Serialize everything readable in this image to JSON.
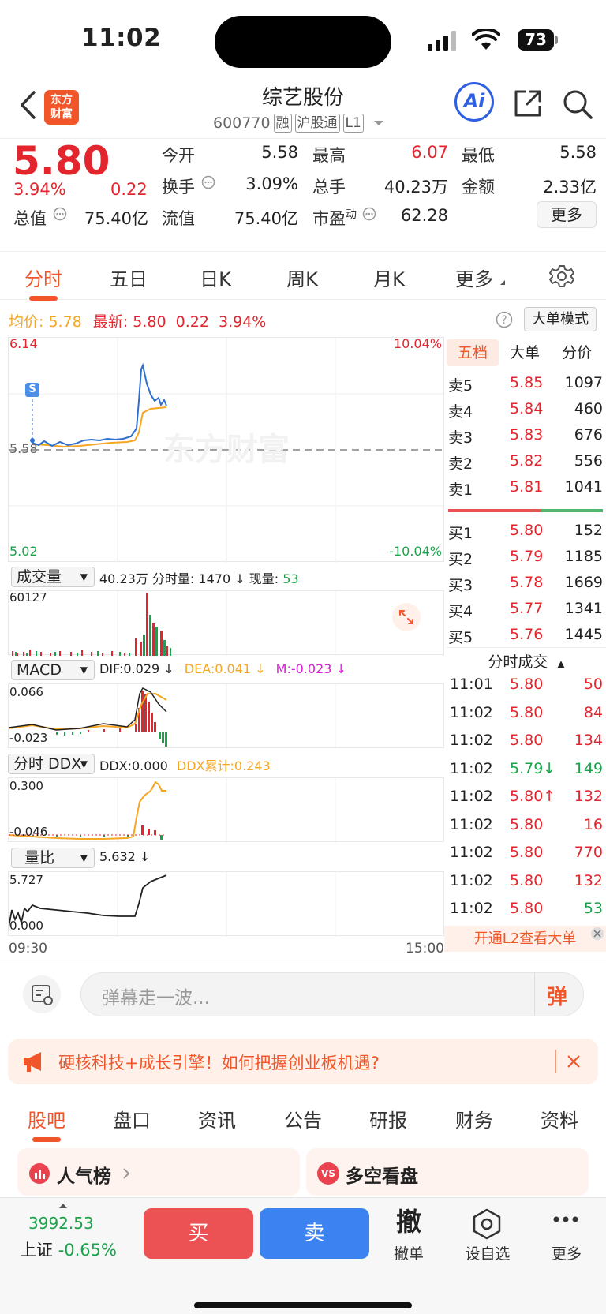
{
  "status": {
    "time": "11:02",
    "battery": "73"
  },
  "header": {
    "logo_line1": "东方",
    "logo_line2": "财富",
    "stock_name": "综艺股份",
    "stock_code": "600770",
    "tags": [
      "融",
      "沪股通",
      "L1"
    ],
    "ai_label": "Ai"
  },
  "quote": {
    "price": "5.80",
    "change_pct": "3.94%",
    "change": "0.22",
    "total_value_label": "总值",
    "total_value": "75.40亿",
    "open_label": "今开",
    "open": "5.58",
    "high_label": "最高",
    "high": "6.07",
    "low_label": "最低",
    "low": "5.58",
    "turnover_label": "换手",
    "turnover": "3.09%",
    "volume_label": "总手",
    "volume": "40.23万",
    "amount_label": "金额",
    "amount": "2.33亿",
    "float_label": "流值",
    "float_value": "75.40亿",
    "pe_label": "市盈",
    "pe_sup": "动",
    "pe": "62.28",
    "more_button": "更多"
  },
  "chart_tabs": [
    "分时",
    "五日",
    "日K",
    "周K",
    "月K",
    "更多"
  ],
  "legend": {
    "avg_label": "均价:",
    "avg": "5.78",
    "latest_label": "最新:",
    "latest": "5.80",
    "latest_change": "0.22",
    "latest_pct": "3.94%",
    "big_order_mode": "大单模式"
  },
  "main_chart": {
    "y_top": "6.14",
    "y_bottom": "5.02",
    "pct_top": "10.04%",
    "pct_bottom": "-10.04%",
    "ref_label": "5.58",
    "marker": "S",
    "watermark": "东方财富"
  },
  "volume_panel": {
    "select": "成交量",
    "total": "40.23万",
    "tick_label": "分时量:",
    "tick_value": "1470 ↓",
    "now_label": "现量:",
    "now_value": "53",
    "y_top": "60127"
  },
  "macd_panel": {
    "select": "MACD",
    "dif": "DIF:0.029 ↓",
    "dea": "DEA:0.041 ↓",
    "m": "M:-0.023 ↓",
    "y_top": "0.066",
    "y_bottom": "-0.023"
  },
  "ddx_panel": {
    "select": "分时 DDX",
    "ddx": "DDX:0.000",
    "ddx_sum": "DDX累计:0.243",
    "y_top": "0.300",
    "y_bottom": "-0.046"
  },
  "ratio_panel": {
    "select": "量比",
    "value": "5.632 ↓",
    "y_top": "5.727",
    "y_bottom": "0.000"
  },
  "time_axis": {
    "start": "09:30",
    "end": "15:00"
  },
  "orderbook_tabs": [
    "五档",
    "大单",
    "分价"
  ],
  "asks": [
    {
      "label": "卖5",
      "price": "5.85",
      "qty": "1097"
    },
    {
      "label": "卖4",
      "price": "5.84",
      "qty": "460"
    },
    {
      "label": "卖3",
      "price": "5.83",
      "qty": "676"
    },
    {
      "label": "卖2",
      "price": "5.82",
      "qty": "556"
    },
    {
      "label": "卖1",
      "price": "5.81",
      "qty": "1041"
    }
  ],
  "bids": [
    {
      "label": "买1",
      "price": "5.80",
      "qty": "152"
    },
    {
      "label": "买2",
      "price": "5.79",
      "qty": "1185"
    },
    {
      "label": "买3",
      "price": "5.78",
      "qty": "1669"
    },
    {
      "label": "买4",
      "price": "5.77",
      "qty": "1341"
    },
    {
      "label": "买5",
      "price": "5.76",
      "qty": "1445"
    }
  ],
  "trades_header": "分时成交",
  "trades": [
    {
      "time": "11:01",
      "price": "5.80",
      "qty": "50",
      "color": "#e3262e"
    },
    {
      "time": "11:02",
      "price": "5.80",
      "qty": "84",
      "color": "#e3262e"
    },
    {
      "time": "11:02",
      "price": "5.80",
      "qty": "134",
      "color": "#e3262e"
    },
    {
      "time": "11:02",
      "price": "5.79↓",
      "qty": "149",
      "color": "#1aa34a"
    },
    {
      "time": "11:02",
      "price": "5.80↑",
      "qty": "132",
      "color": "#e3262e"
    },
    {
      "time": "11:02",
      "price": "5.80",
      "qty": "16",
      "color": "#e3262e"
    },
    {
      "time": "11:02",
      "price": "5.80",
      "qty": "770",
      "color": "#e3262e"
    },
    {
      "time": "11:02",
      "price": "5.80",
      "qty": "132",
      "color": "#e3262e"
    },
    {
      "time": "11:02",
      "price": "5.80",
      "qty": "53",
      "color": "#1aa34a"
    }
  ],
  "l2_banner": "开通L2查看大单",
  "danmaku_placeholder": "弹幕走一波...",
  "danmaku_button": "弹",
  "promo": {
    "text": "硬核科技+成长引擎！如何把握创业板机遇?"
  },
  "bottom_tabs": [
    "股吧",
    "盘口",
    "资讯",
    "公告",
    "研报",
    "财务",
    "资料"
  ],
  "cards": [
    {
      "title": "人气榜",
      "badge": "VS"
    },
    {
      "title": "多空看盘"
    }
  ],
  "bottom_bar": {
    "index_value": "3992.53",
    "index_name": "上证",
    "index_pct": "-0.65%",
    "buy": "买",
    "sell": "卖",
    "cancel_glyph": "撤",
    "cancel_label": "撤单",
    "watch_label": "设自选",
    "more_label": "更多"
  }
}
